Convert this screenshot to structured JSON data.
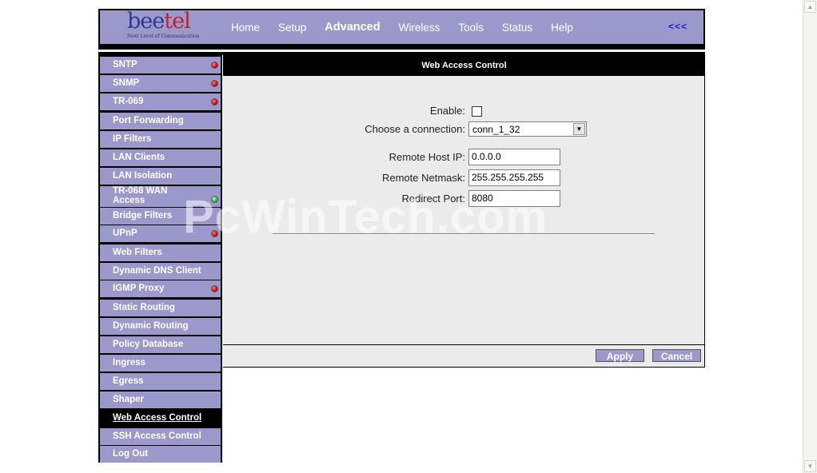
{
  "logo": {
    "brand_a": "bee",
    "brand_b": "tel",
    "tagline": "Next Level of Communication"
  },
  "nav": {
    "items": [
      "Home",
      "Setup",
      "Advanced",
      "Wireless",
      "Tools",
      "Status",
      "Help"
    ],
    "active": "Advanced",
    "back_label": "<<<"
  },
  "sidebar": {
    "items": [
      {
        "label": "SNTP",
        "status": "red"
      },
      {
        "label": "SNMP",
        "status": "red"
      },
      {
        "label": "TR-069",
        "status": "red"
      },
      {
        "label": "Port Forwarding",
        "status": ""
      },
      {
        "label": "IP Filters",
        "status": ""
      },
      {
        "label": "LAN Clients",
        "status": ""
      },
      {
        "label": "LAN Isolation",
        "status": ""
      },
      {
        "label": "TR-068 WAN Access",
        "status": "green"
      },
      {
        "label": "Bridge Filters",
        "status": ""
      },
      {
        "label": "UPnP",
        "status": "red"
      },
      {
        "label": "Web Filters",
        "status": ""
      },
      {
        "label": "Dynamic DNS Client",
        "status": ""
      },
      {
        "label": "IGMP Proxy",
        "status": "red"
      },
      {
        "label": "Static Routing",
        "status": ""
      },
      {
        "label": "Dynamic Routing",
        "status": ""
      },
      {
        "label": "Policy Database",
        "status": ""
      },
      {
        "label": "Ingress",
        "status": ""
      },
      {
        "label": "Egress",
        "status": ""
      },
      {
        "label": "Shaper",
        "status": ""
      },
      {
        "label": "Web Access Control",
        "status": "selected"
      },
      {
        "label": "SSH Access Control",
        "status": ""
      },
      {
        "label": "Log Out",
        "status": ""
      }
    ]
  },
  "main": {
    "title": "Web Access Control",
    "enable_label": "Enable:",
    "enable_checked": false,
    "connection_label": "Choose a connection:",
    "connection_value": "conn_1_32",
    "remote_ip_label": "Remote Host IP:",
    "remote_ip_value": "0.0.0.0",
    "netmask_label": "Remote Netmask:",
    "netmask_value": "255.255.255.255",
    "port_label": "Redirect Port:",
    "port_value": "8080",
    "apply_label": "Apply",
    "cancel_label": "Cancel"
  },
  "watermark": "PcWinTech.com",
  "colors": {
    "nav_bg": "#9b99cc",
    "back_link": "#1a1ad6",
    "status_red": "#e00000",
    "status_green": "#30c030"
  }
}
